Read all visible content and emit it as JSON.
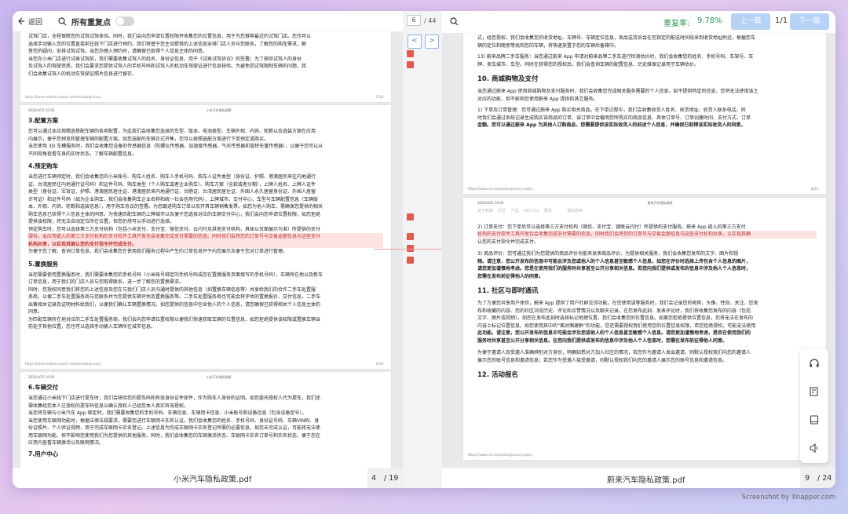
{
  "left": {
    "back_label": "返回",
    "toggle_label": "所有重复点",
    "file_name": "小米汽车隐私政策.pdf",
    "page_current": "4",
    "page_total": "/ 19",
    "page_a": {
      "l1": "试驾门店，全程保障您的试驾试驾体验。同时，我们会向您申请位置权限并收集您的位置信息，用于为您推荐最近的试驾门店。您也可以",
      "l2": "选择手动输入您的位置直接前往线下门店进行预约。我们将基于您主动提供的上述信息安排门店人员与您联系，了解您的购车需求，解",
      "l3": "答您的疑问，安排试驾试驾。当您办理入预约时，请确保已取得个人信息主体的同意。",
      "l4": "当您在小米门店进行试乘试驾前，我们需要收集试驾人的姓名、身份证信息，用于《试乘试驾协议》的签署；为了核验试驾人的身份",
      "l5": "及试驾人的驾驶资质，我们会要求您提供试驾人的手机号码和试驾人的机动车驾驶证进行信息核验。为避免因试驾限制车辆的问题，我",
      "l6": "们会收集试驾人的机动车驾驶证照片信息进行留存。",
      "footer_url": "https://home.mobile.xiaomi.com/miauto/privacy",
      "footer_page": "5/19"
    },
    "page_b": {
      "header_date": "2024/4/25 10:06",
      "header_title": "小米汽车隐私政策",
      "h1": "3.配置方案",
      "s1l1": "您可以通过本应用精选搭配车辆的各项配置，为此我们会收集您选择的车型、版本、电池类型、车辆外观、内饰、轮毂以及选装方案在应用",
      "s1l2": "内展示，便于您预览和管理车辆的配置方案。如您选配的车辆正式开售，您可以按照选配方案进行下单预定或购买。",
      "s1l3": "当您使用 3D 车模服务时，我们会收集您设备的传感器信息（陀螺仪传感器、加速度传感器、气压传感器和旋转矢量传感器），以便于您可以从",
      "s1l4": "不同视角查看车身的实时状态，了解车辆配置信息。",
      "h2": "4.预定购车",
      "s2l1": "当您进行车辆预定时，我们会收集您的小米账号、购车人姓名、购车人手机号码、购车人证件类型（身份证、护照、港澳居民来往内地通行",
      "s2l2": "证、台湾居民往内地通行证号码）和证件号码、购车类型（个人购车或者企业购车）、购车方案（全款或者分期），上牌人姓名、上牌人证件",
      "s2l3": "类型（身份证、军官证、护照、港澳居民居住证、港澳居民来内地通行证、台胞证、台湾居民居住证、外国人永久居留身份证、外国人居留",
      "s2l4": "许可证）和证件号码（如为企业购车，我们会收集购车企业名称和统一社会信用代码）、上牌城市、交付中心、车型与车辆配置信息（车辆版",
      "s2l5": "本、外观、内饰、轮毂和选装信息），用于购车协议的签署。为您跟进购车订单以及开具车辆销售发票。如您为他人购车，需确保您提供的相关",
      "s2l6": "购车信息已获得个人信息主体的同意。为快速匹配车辆的上牌城市以及便于您选择对应的车辆交付中心，我们会向您申请位置权限，如您拒绝",
      "s2l7": "提供该权限，将无法自动定位所在位置，但您仍然可以手动进行选择。",
      "s2l8": "预定购车时，您可以选择第三方支付机构（包括小米支付、支付宝、微信支付、云闪付及其他支付机构，具体以页面展示为准）所提供的支付",
      "s2l9": "服务。本应用嵌入的第三方支付机构的支付软件工具开发包会收集完成支付需要的信息。同时我们会将您的订单号与交易金额信息与这些支付",
      "s2l10": "机构共享，以实现其确认您的支付指令并完成支付。",
      "s2l11": "为便于您了解、查询订单信息，我们会收集您在使用我们服务过程中产生的订单信息并于向您展示及便于您对订单进行管理。",
      "h3": "5.置换服务",
      "s3l1": "当您需要使用置换服务时，我们需要收集您的手机号码（小米账号绑定的手机号码或您在置换服务页面填写的手机号码），车辆所在地以及新车",
      "s3l2": "订单信息，用于我们的门店人员与您取得联系，进一步了解您的置换需求。",
      "s3l3": "同时，您授权同意我们将您的上述信息及您在与我们门店人员沟通时提供的其他信息（如置换车辆信息等）共享给我们的合作二手车处置服",
      "s3l4": "务商，以便二手车处置服务商与您联系并为您提供车辆评估及置换服务等。二手车处置服务商也可能会将评估的置换报价、交付信息，二手车",
      "s3l5": "出售相关记录及证明材料给我们，以便我们确认车辆置换情况。如您提供的信息中包含他人的个人信息，请您确保已获得相关个人信息主体的",
      "s3l6": "同意。",
      "s3l7": "为匹配车辆所在地对应的二手车处置服务商，我们会向您申请位置权限以便我们快速获取车辆的位置信息，如您拒绝提供该权限或置换车辆当",
      "s3l8": "前处于其他位置，您也可以选择手动输入车辆所在城市信息。",
      "footer_url": "https://home.mobile.xiaomi.com/miauto/privacy",
      "footer_page": "6/19"
    },
    "page_c": {
      "header_date": "2024/4/25 10:06",
      "header_title": "小米汽车隐私政策",
      "h1": "6.车辆交付",
      "l1": "当您通过小米线下门店进行提车时，我们会核验您的提车码和有效身份证件原件，作为购车人身份的证明。如您委托授权人代为提车，我们还",
      "l2": "需收集经您本人已授权的提车码信息以确认授权人已经您本人真实有效授权。",
      "l3": "当您将车辆与小米汽车 App 绑定时，我们需要收集您的手机号码、车辆信息、车辆用卡信息、小米账号和设备信息（包含设备型号）。",
      "l4": "当您使用车联网功能时，根据法律法规要求，需要您进行车联网卡实名认证。我们会收集您的姓名、手机号码、身份证号码、车辆VIN码、身",
      "l5": "份证照片、个人验证视频，用于完成车联网卡实名登记。上述信息为完成车联网卡实名登记所需的必要信息，如您未完成认证，可能将无法使",
      "l6": "用车联网功能，但不影响您使用我们为您提供的其他服务。同时，我们会收集您的车辆激活状态、车联网卡实名订单号和实名状态，便于您在",
      "l7": "应用内查看车辆激活以及联网情况。",
      "h2": "7.用户中心"
    }
  },
  "middle": {
    "page_input": "6",
    "page_total": "/ 44",
    "prev_icon": "<",
    "next_icon": ">"
  },
  "right": {
    "similarity_label": "重复率:",
    "similarity_value": "9.78%",
    "prev_btn": "上一篇",
    "doc_count": "1/1",
    "next_btn": "下一篇",
    "file_name": "蔚来汽车隐私政策.pdf",
    "page_current": "9",
    "page_total": "/ 24",
    "page_a": {
      "l0": "式，经您授权，我们会收集您的收货地址、车牌号、车辆定位信息，商品送货员会在您指定的配送时间段来到收货地址附近，根据您车",
      "l0b": "辆的定位和随意等找到您的车辆，将快递放置于您的车辆后备箱中。",
      "l1": "13)  蔚来品牌二手车服务：当您通过蔚来 App 申请对蔚来品牌二手车进行检测估价时，我们会收集您的姓名、手机号码、车架号、车",
      "l1b": "牌、卖车城市、车型。同时在获得您的授权后，我们会查询车辆的配置信息、历史维保记录用于车辆估价。",
      "h1": "10.  商城购物及支付",
      "l2": "当您通过蔚来 App 使用商城购物及支付服务时，我们会收集您完成相关服务需要的个人信息，如不提供特定的信息，您将无法使用该之",
      "l2b": "对应的功能，但不影响您使用蔚来 App 提供的其它服务。",
      "l3": "1)  下单及订单管理：您可通过蔚来 App 购买相关商品。在下单过程中，我们会收集收货人姓名、收货地址、收货人联系电话。同",
      "l3b": "时我们会通过系统记录生成购买该商品的订单，该订单中会载明您所购买的商品信息、具体订单号、订单创建时间、支付方式、订单",
      "l3c": "金额。您可以通过蔚来 App 为其他人订购商品，您需要提供该实际收货人的前述个人信息，并确保已取得该实际收货人的同意。",
      "footer_url": "https://www.nio.cn/policies/privacy-policy",
      "footer_page": "8/24"
    },
    "page_b": {
      "header_date": "2024/4/25 10:06",
      "header_title": "蔚来汽车隐私政策",
      "faded": "关于蔚来    社区    产品    NIO Life    服务            我的蔚来",
      "l1": "2)  订单支付：您下单后可以选择第三方支付机构（微信、支付宝、银联云闪付）所提供的支付服务。蔚来 App 嵌入的第三方支付",
      "l1b": "机构的支付软件工具开发包会收集完成支付需要的信息。同时我们会将您的订单号与交易金额信息与这些支付机构共享，以实现其确",
      "l1c": "认您的支付指令并完成支付。",
      "l2": "3)  商品评价：您可通过我们为您提供的商品评价功能来发表商品评价。为提供相关服务，我们会收集您发布的文字、图片和视",
      "l2b": "频。请注意，您公开发布的信息中可能会涉及您或他人的个人信息甚至敏感个人信息，如您在评价时选择上传包含个人信息的图片，",
      "l2c": "请您更加谨慎地考虑。您是在使用我们的服务时共享甚至公开分享相关信息。若您向我们提供或发布的信息中涉及他人个人信息时，",
      "l2d": "您需在发布前征得他人的同意。",
      "h1": "11.  社区与即时通讯",
      "l3": "为了方便您共享用户体验，蔚来 App 提供了用户社群交流功能。在您使用该等服务时，我们会记录您的昵称、头像、性别、关注、您发",
      "l3b": "布和收藏的内容、您的社区浏览历史、评论和点赞情况以及聊天记录。在您发布此刻、发表评论时，我们将收集您发布的内容（包括",
      "l3c": "文字、图片或视频）。如您在发布此刻时选择标记地理位置，我们会收集您的位置信息。如果您拒绝提供位置信息，您将无法在发布的",
      "l3d": "内容上标记位置信息。如您使用其中的“面对面建群”的功能，您还需要授权我们使用您的位置信息权限，若您拒绝授权，可能无法使用",
      "l3e": "此功能。请注意，您公开发布的信息中可能会涉及您或他人的个人信息甚至敏感个人信息。请您更加谨慎地考虑，是否在使用我们的",
      "l3f": "服务时共享甚至公开分享相关信息。在您向我们提供或发布的信息中涉及他人个人信息时，您需在发布前征得他人同意。",
      "l4": "为便于邀请人及受邀人准确辨别对方身份，明确知悉对方加入社区的情况，若您作为邀请人发出邀请，则默认授权我们向您的邀请人",
      "l4b": "展示您的账号信息和邀请信息；若您作为受邀人接受邀请，则默认授权我们向您的邀请人展示您的账号信息和邀请信息。",
      "h2": "12.  活动报名",
      "footer_url": "https://www.nio.cn/policies/privacy-policy",
      "footer_page": "9/24"
    }
  },
  "watermark": "Screenshot by Xnapper.com"
}
